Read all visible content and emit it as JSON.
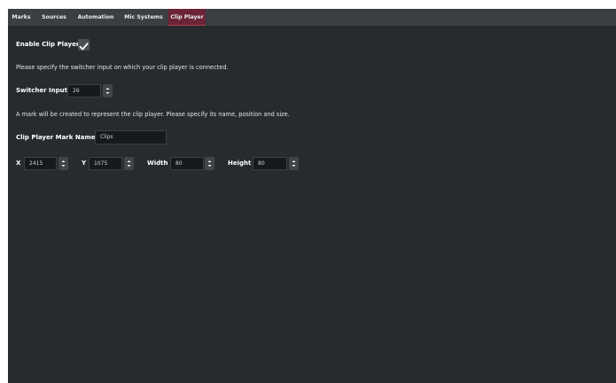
{
  "tabs": [
    {
      "label": "Marks",
      "active": false
    },
    {
      "label": "Sources",
      "active": false
    },
    {
      "label": "Automation",
      "active": false
    },
    {
      "label": "Mic Systems",
      "active": false
    },
    {
      "label": "Clip Player",
      "active": true
    }
  ],
  "enable": {
    "label": "Enable Clip Player",
    "checked": true
  },
  "switcher_help": "Please specify the switcher input on which your clip player is connected.",
  "switcher": {
    "label": "Switcher Input",
    "value": "26"
  },
  "mark_help": "A mark will be created to represent the clip player. Please specify its name, position and size.",
  "mark_name": {
    "label": "Clip Player Mark Name",
    "value": "Clips"
  },
  "x": {
    "label": "X",
    "value": "2415"
  },
  "y": {
    "label": "Y",
    "value": "1075"
  },
  "width": {
    "label": "Width",
    "value": "80"
  },
  "height": {
    "label": "Height",
    "value": "80"
  },
  "colors": {
    "background": "#272b2e",
    "tabbar": "#3a3f44",
    "active_tab": "#6b2435"
  }
}
